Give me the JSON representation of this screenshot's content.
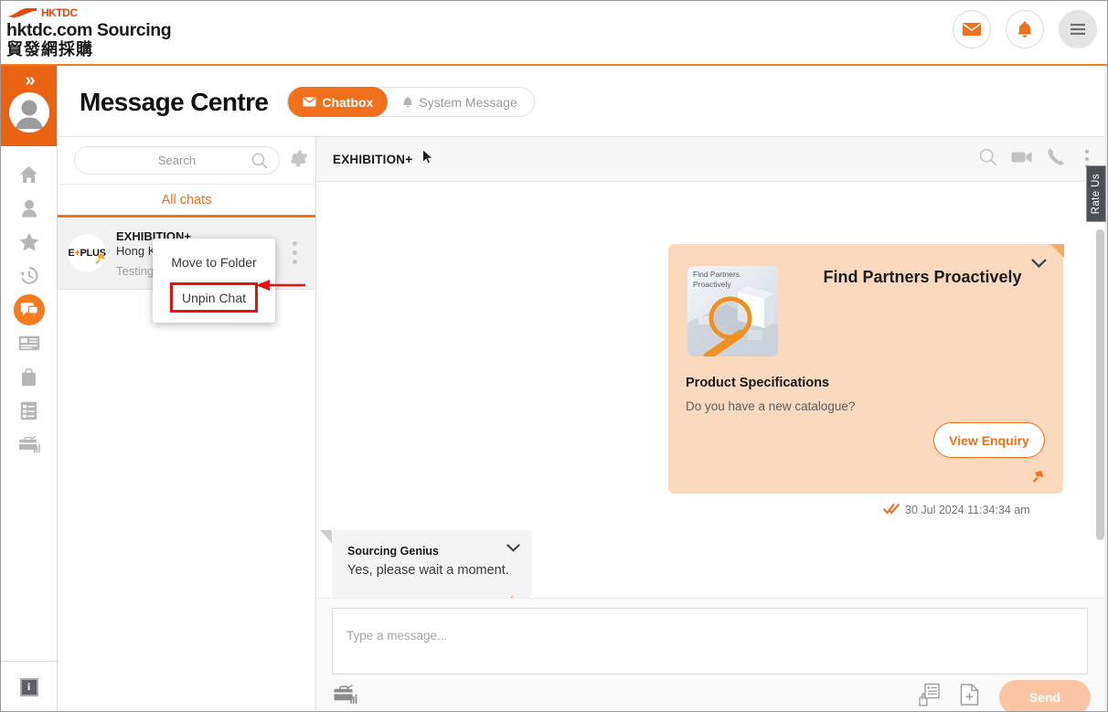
{
  "brand": {
    "logo_text": "HKTDC",
    "line1": "hktdc.com Sourcing",
    "line2": "貿發網採購",
    "actions": [
      {
        "name": "mail-icon",
        "label": "Messages"
      },
      {
        "name": "bell-icon",
        "label": "Notifications"
      },
      {
        "name": "hamburger-icon",
        "label": "Menu"
      }
    ]
  },
  "rail": {
    "expand_label": "»",
    "items": [
      {
        "icon": "home-icon",
        "label": "Home"
      },
      {
        "icon": "person-icon",
        "label": "My Account"
      },
      {
        "icon": "star-icon",
        "label": "Favourites"
      },
      {
        "icon": "history-icon",
        "label": "Recently Viewed"
      },
      {
        "icon": "chat-icon",
        "label": "Message Centre",
        "active": true
      },
      {
        "icon": "card-icon",
        "label": "Name Card"
      },
      {
        "icon": "bag-icon",
        "label": "Shopping Bag"
      },
      {
        "icon": "list-icon",
        "label": "Sourcing List"
      },
      {
        "icon": "briefcase-chart-icon",
        "label": "Business"
      }
    ],
    "info_label": "i"
  },
  "header": {
    "title": "Message Centre",
    "tabs": [
      {
        "label": "Chatbox",
        "icon": "envelope-icon",
        "active": true
      },
      {
        "label": "System Message",
        "icon": "bell-icon",
        "active": false
      }
    ]
  },
  "list": {
    "search": {
      "placeholder": "Search",
      "value": ""
    },
    "settings_icon": "gear-icon",
    "tab_label": "All chats",
    "rows": [
      {
        "avatar_text": "E",
        "avatar_suffix": "PLUS",
        "name": "EXHIBITION+",
        "subtitle": "Hong Kong",
        "snippet": "Testing only",
        "pinned": true
      }
    ]
  },
  "context_menu": {
    "items": [
      {
        "label": "Move to Folder",
        "highlighted": false
      },
      {
        "label": "Unpin Chat",
        "highlighted": true
      }
    ],
    "highlight_color": "#e8110f"
  },
  "conversation": {
    "title": "EXHIBITION+",
    "actions": [
      {
        "name": "search-icon"
      },
      {
        "name": "video-camera-icon"
      },
      {
        "name": "phone-icon"
      },
      {
        "name": "more-vertical-icon"
      }
    ],
    "card_message": {
      "thumb_label": "Find Partners\nProactively",
      "thumb_line1": "Find Partners",
      "thumb_line2": "Proactively",
      "heading": "Find Partners Proactively",
      "subheading": "Product Specifications",
      "body": "Do you have a new catalogue?",
      "button_label": "View Enquiry",
      "timestamp": "30 Jul 2024 11:34:34 am",
      "pinned": true
    },
    "reply_message": {
      "sender": "Sourcing Genius",
      "text": "Yes, please wait a moment."
    }
  },
  "composer": {
    "placeholder": "Type a message...",
    "left_icon": "briefcase-chart-icon",
    "right_icons": [
      {
        "name": "quotation-icon"
      },
      {
        "name": "attach-file-icon"
      }
    ],
    "send_label": "Send"
  },
  "rate_us": {
    "label": "Rate Us"
  },
  "colors": {
    "brand_orange": "#f0701b",
    "rail_orange": "#ea6312",
    "card_bg": "#fbd9bd",
    "annotation_red": "#e8110f"
  }
}
